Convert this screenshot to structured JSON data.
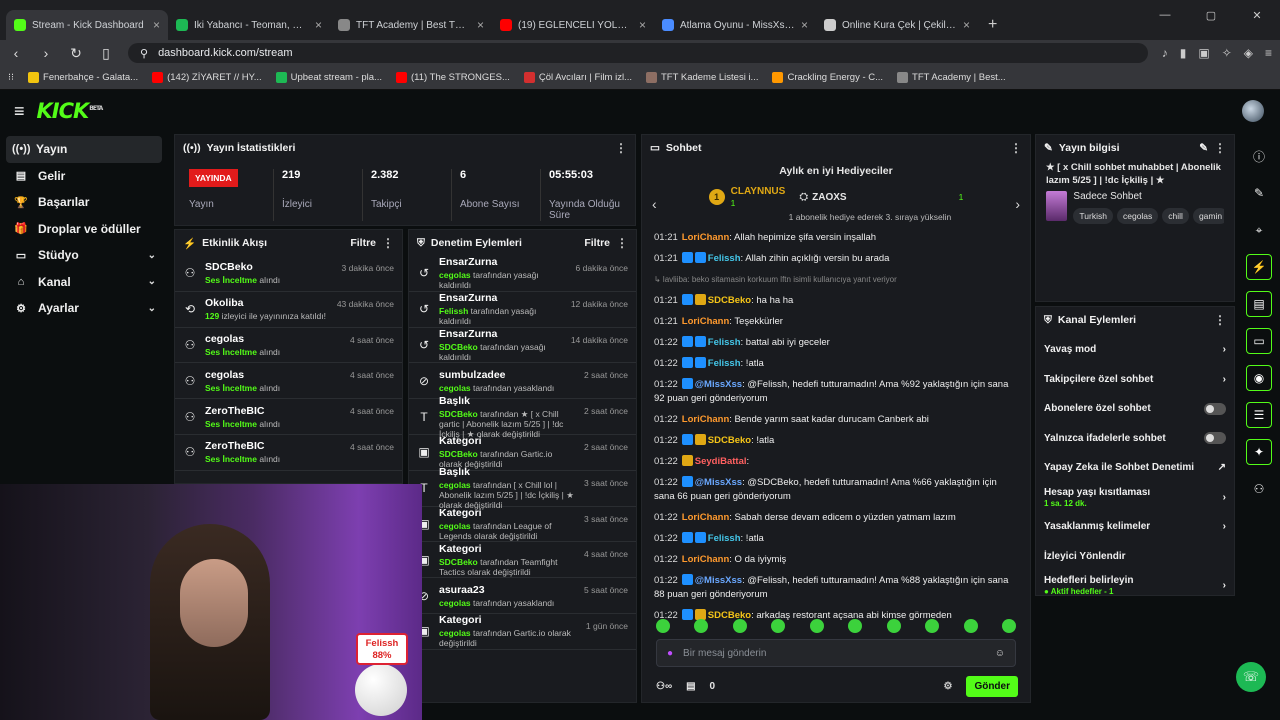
{
  "browser": {
    "tabs": [
      {
        "label": "Stream - Kick Dashboard",
        "color": "#53fc18",
        "active": true
      },
      {
        "label": "İki Yabancı - Teoman, Şebnem Fe",
        "color": "#1db954",
        "active": false
      },
      {
        "label": "TFT Academy | Best TFT Comps curat",
        "color": "#888888",
        "active": false
      },
      {
        "label": "(19) EĞLENCELİ YOLCULUĞUN SONU",
        "color": "#ff0000",
        "active": false
      },
      {
        "label": "Atlama Oyunu - MissXss AI Bot Syste",
        "color": "#4a8cff",
        "active": false
      },
      {
        "label": "Online Kura Çek | Çekiliş Yap",
        "color": "#cccccc",
        "active": false
      }
    ],
    "url": "dashboard.kick.com/stream",
    "bookmarks": [
      {
        "label": "Fenerbahçe - Galata...",
        "color": "#f1c40f"
      },
      {
        "label": "(142) ZİYARET // HY...",
        "color": "#ff0000"
      },
      {
        "label": "Upbeat stream - pla...",
        "color": "#1db954"
      },
      {
        "label": "(11) The STRONGES...",
        "color": "#ff0000"
      },
      {
        "label": "Çöl Avcıları | Film izl...",
        "color": "#d32f2f"
      },
      {
        "label": "TFT Kademe Listesi i...",
        "color": "#8d6e63"
      },
      {
        "label": "Crackling Energy - C...",
        "color": "#ff9800"
      },
      {
        "label": "TFT Academy | Best...",
        "color": "#888888"
      }
    ]
  },
  "app": {
    "logo": "KICK",
    "logo_sup": "BETA"
  },
  "sidebar": [
    {
      "label": "Yayın",
      "icon": "broadcast-icon",
      "glyph": "((•))",
      "chevron": false,
      "active": true
    },
    {
      "label": "Gelir",
      "icon": "revenue-icon",
      "glyph": "▤",
      "chevron": false,
      "active": false
    },
    {
      "label": "Başarılar",
      "icon": "trophy-icon",
      "glyph": "🏆",
      "chevron": false,
      "active": false
    },
    {
      "label": "Droplar ve ödüller",
      "icon": "gift-icon",
      "glyph": "🎁",
      "chevron": false,
      "active": false
    },
    {
      "label": "Stüdyo",
      "icon": "studio-icon",
      "glyph": "▭",
      "chevron": true,
      "active": false
    },
    {
      "label": "Kanal",
      "icon": "home-icon",
      "glyph": "⌂",
      "chevron": true,
      "active": false
    },
    {
      "label": "Ayarlar",
      "icon": "gear-icon",
      "glyph": "⚙",
      "chevron": true,
      "active": false
    }
  ],
  "stats_panel": {
    "title": "Yayın İstatistikleri",
    "live_badge": "YAYINDA",
    "live_label": "Yayın",
    "items": [
      {
        "value": "219",
        "label": "İzleyici"
      },
      {
        "value": "2.382",
        "label": "Takipçi"
      },
      {
        "value": "6",
        "label": "Abone Sayısı"
      },
      {
        "value": "05:55:03",
        "label": "Yayında Olduğu Süre"
      }
    ]
  },
  "activity": {
    "title": "Etkinlik Akışı",
    "filter": "Filtre",
    "rows": [
      {
        "icon": "follow-icon",
        "glyph": "⚇",
        "name": "SDCBeko",
        "time": "3 dakika önce",
        "hl": "Ses İnceltme",
        "rest": " alındı"
      },
      {
        "icon": "raid-icon",
        "glyph": "⟲",
        "name": "Okoliba",
        "time": "43 dakika önce",
        "hl": "129",
        "rest": " izleyici ile yayınınıza katıldı!"
      },
      {
        "icon": "follow-icon",
        "glyph": "⚇",
        "name": "cegolas",
        "time": "4 saat önce",
        "hl": "Ses İnceltme",
        "rest": " alındı"
      },
      {
        "icon": "follow-icon",
        "glyph": "⚇",
        "name": "cegolas",
        "time": "4 saat önce",
        "hl": "Ses İnceltme",
        "rest": " alındı"
      },
      {
        "icon": "follow-icon",
        "glyph": "⚇",
        "name": "ZeroTheBIC",
        "time": "4 saat önce",
        "hl": "Ses İnceltme",
        "rest": " alındı"
      },
      {
        "icon": "follow-icon",
        "glyph": "⚇",
        "name": "ZeroTheBIC",
        "time": "4 saat önce",
        "hl": "Ses İnceltme",
        "rest": " alındı"
      }
    ]
  },
  "moderation": {
    "title": "Denetim Eylemleri",
    "filter": "Filtre",
    "rows": [
      {
        "icon": "unban-icon",
        "glyph": "↺",
        "name": "EnsarZurna",
        "time": "6 dakika önce",
        "hl": "cegolas",
        "rest": " tarafından yasağı kaldırıldı"
      },
      {
        "icon": "unban-icon",
        "glyph": "↺",
        "name": "EnsarZurna",
        "time": "12 dakika önce",
        "hl": "Felissh",
        "rest": " tarafından yasağı kaldırıldı"
      },
      {
        "icon": "unban-icon",
        "glyph": "↺",
        "name": "EnsarZurna",
        "time": "14 dakika önce",
        "hl": "SDCBeko",
        "rest": " tarafından yasağı kaldırıldı"
      },
      {
        "icon": "ban-icon",
        "glyph": "⊘",
        "name": "sumbulzadee",
        "time": "2 saat önce",
        "hl": "cegolas",
        "rest": " tarafından yasaklandı"
      },
      {
        "icon": "title-icon",
        "glyph": "T",
        "name": "Başlık",
        "time": "2 saat önce",
        "hl": "SDCBeko",
        "rest": " tarafından ★ [ x Chill gartic | Abonelik lazım 5/25 ] | !dc İçkiliş | ★ olarak değiştirildi"
      },
      {
        "icon": "category-icon",
        "glyph": "▣",
        "name": "Kategori",
        "time": "2 saat önce",
        "hl": "SDCBeko",
        "rest": " tarafından Gartic.io olarak değiştirildi"
      },
      {
        "icon": "title-icon",
        "glyph": "T",
        "name": "Başlık",
        "time": "3 saat önce",
        "hl": "cegolas",
        "rest": " tarafından [ x Chill lol | Abonelik lazım 5/25 ] | !dc İçkiliş | ★ olarak değiştirildi"
      },
      {
        "icon": "category-icon",
        "glyph": "▣",
        "name": "Kategori",
        "time": "3 saat önce",
        "hl": "cegolas",
        "rest": " tarafından League of Legends olarak değiştirildi"
      },
      {
        "icon": "category-icon",
        "glyph": "▣",
        "name": "Kategori",
        "time": "4 saat önce",
        "hl": "SDCBeko",
        "rest": " tarafından Teamfight Tactics olarak değiştirildi"
      },
      {
        "icon": "ban-icon",
        "glyph": "⊘",
        "name": "asuraa23",
        "time": "5 saat önce",
        "hl": "cegolas",
        "rest": " tarafından yasaklandı"
      },
      {
        "icon": "category-icon",
        "glyph": "▣",
        "name": "Kategori",
        "time": "1 gün önce",
        "hl": "cegolas",
        "rest": " tarafından Gartic.io olarak değiştirildi"
      }
    ]
  },
  "chat": {
    "title": "Sohbet",
    "gifters_title": "Aylık en iyi Hediyeciler",
    "gifter1": {
      "name": "CLAYNNUS",
      "count": "1",
      "rank": "1"
    },
    "gifter2": {
      "name": "ZAOXS",
      "count": "1"
    },
    "gift_note": "1 abonelik hediye ederek 3. sıraya yükselin",
    "messages": [
      {
        "time": "01:21",
        "user": "LoriChann",
        "color": "#ff9a2e",
        "badges": [],
        "text": ": Allah hepimize şifa versin inşallah"
      },
      {
        "time": "01:21",
        "user": "Felissh",
        "color": "#44c6e8",
        "badges": [
          "#1e90ff",
          "#1e90ff"
        ],
        "text": ": Allah zihin açıklığı versin bu arada"
      },
      {
        "time": "",
        "user": "",
        "color": "#888",
        "badges": [],
        "text": "↳ lavliiba: beko sitamasin korkuum lftn isimli kullanıcıya yanıt veriyor"
      },
      {
        "time": "01:21",
        "user": "SDCBeko",
        "color": "#f5c518",
        "badges": [
          "#1e90ff",
          "#e0a814"
        ],
        "text": ": ha ha ha"
      },
      {
        "time": "01:21",
        "user": "LoriChann",
        "color": "#ff9a2e",
        "badges": [],
        "text": ": Teşekkürler"
      },
      {
        "time": "01:22",
        "user": "Felissh",
        "color": "#44c6e8",
        "badges": [
          "#1e90ff",
          "#1e90ff"
        ],
        "text": ": battal abi iyi geceler"
      },
      {
        "time": "01:22",
        "user": "Felissh",
        "color": "#44c6e8",
        "badges": [
          "#1e90ff",
          "#1e90ff"
        ],
        "text": ": !atla"
      },
      {
        "time": "01:22",
        "user": "@MissXss",
        "color": "#6aa8ff",
        "badges": [
          "#1e90ff"
        ],
        "text": ": @Felissh, hedefi tutturamadın! Ama %92 yaklaştığın için sana 92 puan geri gönderiyorum"
      },
      {
        "time": "01:22",
        "user": "LoriChann",
        "color": "#ff9a2e",
        "badges": [],
        "text": ": Bende yarım saat kadar durucam Canberk abi"
      },
      {
        "time": "01:22",
        "user": "SDCBeko",
        "color": "#f5c518",
        "badges": [
          "#1e90ff",
          "#e0a814"
        ],
        "text": ": !atla"
      },
      {
        "time": "01:22",
        "user": "SeydiBattal",
        "color": "#ff6060",
        "badges": [
          "#e0a814"
        ],
        "text": ":"
      },
      {
        "time": "01:22",
        "user": "@MissXss",
        "color": "#6aa8ff",
        "badges": [
          "#1e90ff"
        ],
        "text": ": @SDCBeko, hedefi tutturamadın! Ama %66 yaklaştığın için sana 66 puan geri gönderiyorum"
      },
      {
        "time": "01:22",
        "user": "LoriChann",
        "color": "#ff9a2e",
        "badges": [],
        "text": ": Sabah derse devam edicem o yüzden yatmam lazım"
      },
      {
        "time": "01:22",
        "user": "Felissh",
        "color": "#44c6e8",
        "badges": [
          "#1e90ff",
          "#1e90ff"
        ],
        "text": ": !atla"
      },
      {
        "time": "01:22",
        "user": "LoriChann",
        "color": "#ff9a2e",
        "badges": [],
        "text": ": O da iyiymiş"
      },
      {
        "time": "01:22",
        "user": "@MissXss",
        "color": "#6aa8ff",
        "badges": [
          "#1e90ff"
        ],
        "text": ": @Felissh, hedefi tutturamadın! Ama %88 yaklaştığın için sana 88 puan geri gönderiyorum"
      },
      {
        "time": "01:22",
        "user": "SDCBeko",
        "color": "#f5c518",
        "badges": [
          "#1e90ff",
          "#e0a814"
        ],
        "text": ": arkadaş restorant açsana abi kimse görmeden"
      }
    ],
    "input_placeholder": "Bir mesaj gönderin",
    "points": "0",
    "send": "Gönder"
  },
  "stream_info": {
    "title": "Yayın bilgisi",
    "stream_title": "★ [ x Chill sohbet muhabbet | Abonelik lazım 5/25 ] | !dc İçkiliş | ★",
    "category": "Sadece Sohbet",
    "tags": [
      "Turkish",
      "cegolas",
      "chill",
      "gamin"
    ]
  },
  "channel_actions": {
    "title": "Kanal Eylemleri",
    "items": [
      {
        "label": "Yavaş mod",
        "control": "chevron",
        "sub": ""
      },
      {
        "label": "Takipçilere özel sohbet",
        "control": "chevron",
        "sub": ""
      },
      {
        "label": "Abonelere özel sohbet",
        "control": "toggle",
        "sub": ""
      },
      {
        "label": "Yalnızca ifadelerle sohbet",
        "control": "toggle",
        "sub": ""
      },
      {
        "label": "Yapay Zeka ile Sohbet Denetimi",
        "control": "external",
        "sub": ""
      },
      {
        "label": "Hesap yaşı kısıtlaması",
        "control": "chevron",
        "sub": "1 sa. 12 dk."
      },
      {
        "label": "Yasaklanmış kelimeler",
        "control": "chevron",
        "sub": ""
      },
      {
        "label": "İzleyici Yönlendir",
        "control": "none",
        "sub": ""
      },
      {
        "label": "Hedefleri belirleyin",
        "control": "chevron",
        "sub": "● Aktif hedefler - 1"
      }
    ]
  },
  "overlay": {
    "name": "Felissh",
    "percent": "88%"
  }
}
